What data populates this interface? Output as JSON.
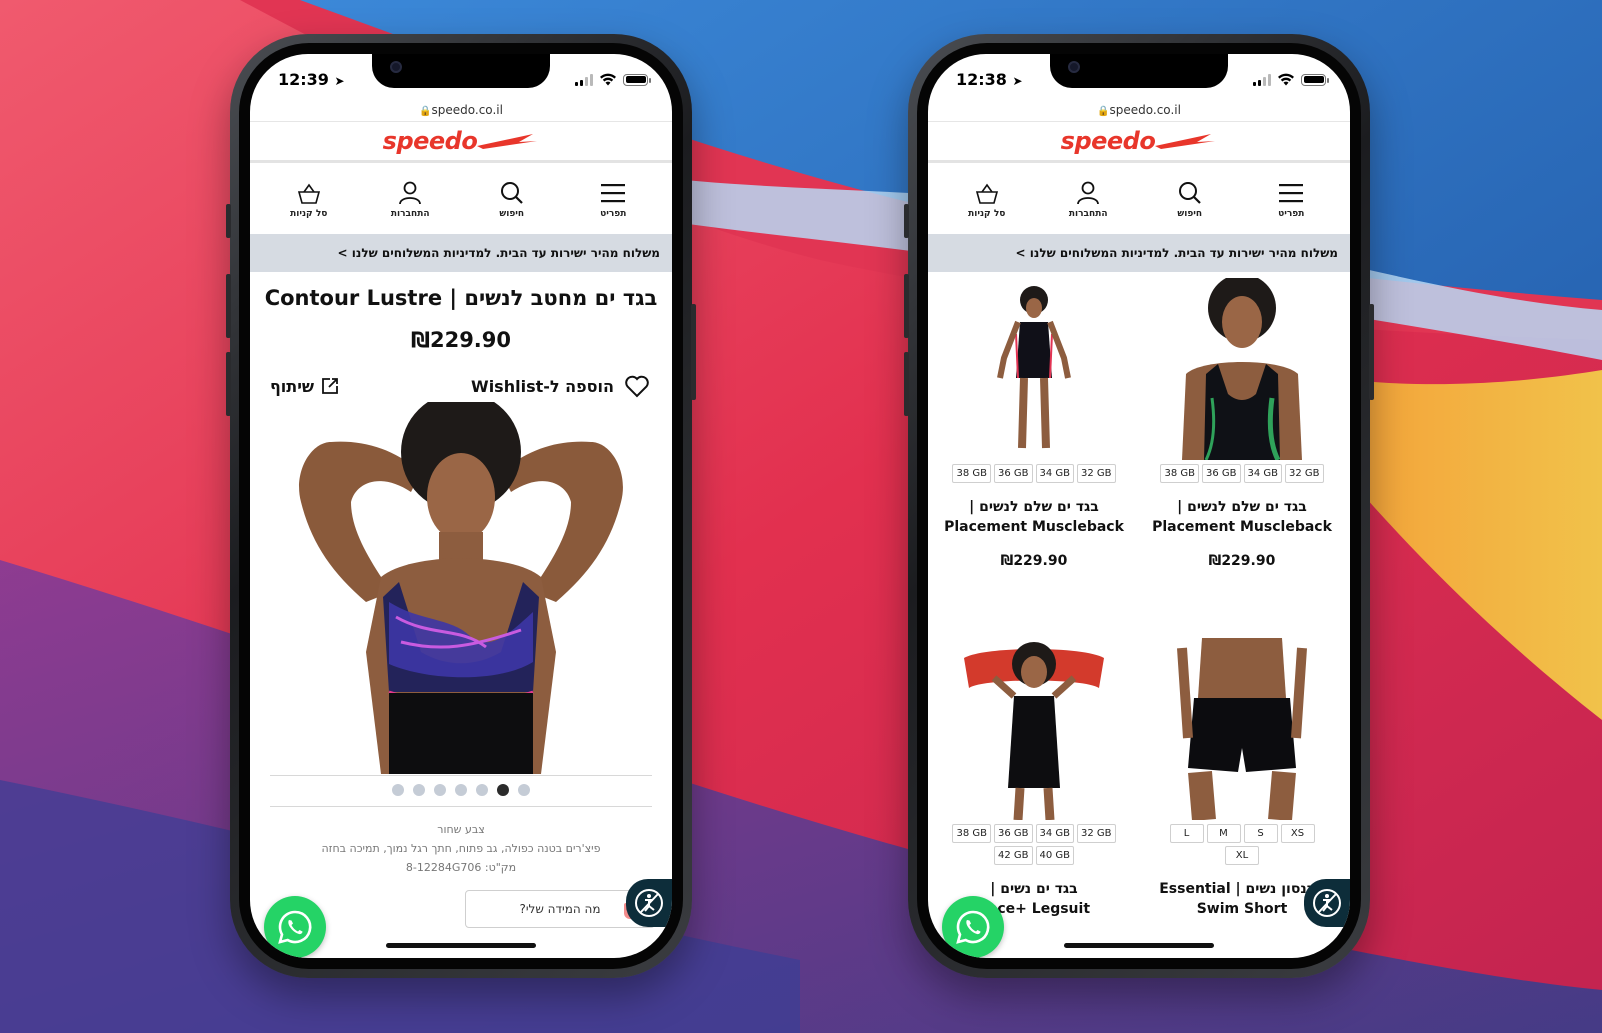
{
  "colors": {
    "brand_red": "#e8362b",
    "banner_bg": "#d6dbe2",
    "whatsapp_green": "#25d366",
    "accessibility_navy": "#0d2d3a"
  },
  "brand": {
    "logo_text": "speedo"
  },
  "left_phone": {
    "status": {
      "time": "12:39",
      "signal_bars_active": 2,
      "signal_bars_total": 4,
      "battery_level": 1.0
    },
    "url": "speedo.co.il",
    "nav": [
      {
        "label": "תפריט",
        "icon": "menu-icon"
      },
      {
        "label": "חיפוש",
        "icon": "search-icon"
      },
      {
        "label": "התחברות",
        "icon": "user-icon"
      },
      {
        "label": "סל קניות",
        "icon": "basket-icon"
      }
    ],
    "banner": "משלוח מהיר ישירות עד הבית. למדיניות המשלוחים שלנו >",
    "product": {
      "title": "Contour Lustre | בגד ים מחטב לנשים",
      "price": "₪229.90",
      "wishlist_label": "הוספה ל-Wishlist",
      "share_label": "שיתוף",
      "gallery_count": 7,
      "gallery_active_index": 1,
      "color_line": "צבע שחור",
      "features_line": "פיצ'רים בטנה כפולה, גב פתוח, חתך רגל נמוך, תמיכה בחזה",
      "sku_line": "מק\"ט: 8-12284G706",
      "size_finder_label": "מה המידה שלי?"
    }
  },
  "right_phone": {
    "status": {
      "time": "12:38",
      "signal_bars_active": 2,
      "signal_bars_total": 4,
      "battery_level": 1.0
    },
    "url": "speedo.co.il",
    "nav": [
      {
        "label": "תפריט",
        "icon": "menu-icon"
      },
      {
        "label": "חיפוש",
        "icon": "search-icon"
      },
      {
        "label": "התחברות",
        "icon": "user-icon"
      },
      {
        "label": "סל קניות",
        "icon": "basket-icon"
      }
    ],
    "banner": "משלוח מהיר ישירות עד הבית. למדיניות המשלוחים שלנו >",
    "products": [
      {
        "sizes": [
          "32 GB",
          "34 GB",
          "36 GB",
          "38 GB"
        ],
        "name_he": "בגד ים שלם לנשים |",
        "name_en": "Placement Muscleback",
        "price": "₪229.90"
      },
      {
        "sizes": [
          "32 GB",
          "34 GB",
          "36 GB",
          "38 GB"
        ],
        "name_he": "בגד ים שלם לנשים |",
        "name_en": "Placement Muscleback",
        "price": "₪229.90"
      },
      {
        "sizes": [
          "XS",
          "S",
          "M",
          "L",
          "XL"
        ],
        "name_he": "מכנסון נשים | Essential",
        "name_en": "Swim Short",
        "price": ""
      },
      {
        "sizes": [
          "32 GB",
          "34 GB",
          "36 GB",
          "38 GB",
          "40 GB",
          "42 GB"
        ],
        "name_he": "בגד ים נשים |",
        "name_en": "ance+ Legsuit",
        "price": ""
      }
    ]
  }
}
